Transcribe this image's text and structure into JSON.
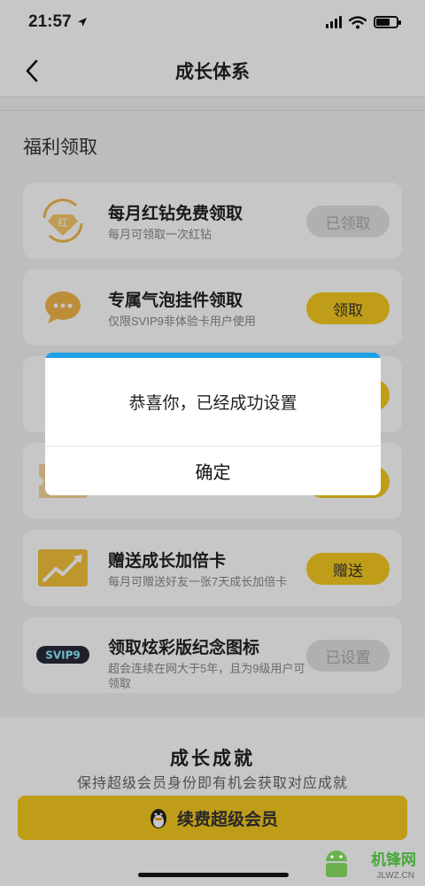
{
  "status": {
    "time": "21:57"
  },
  "nav": {
    "title": "成长体系"
  },
  "section": {
    "title": "福利领取"
  },
  "cards": [
    {
      "title": "每月红钻免费领取",
      "subtitle": "每月可领取一次红钻",
      "button": "已领取",
      "icon_label": "红",
      "state": "disabled"
    },
    {
      "title": "专属气泡挂件领取",
      "subtitle": "仅限SVIP9非体验卡用户使用",
      "button": "领取",
      "state": "active"
    },
    {
      "title": "",
      "subtitle": "",
      "button": "",
      "state": "active"
    },
    {
      "title": "",
      "subtitle": "",
      "button": "",
      "state": "active"
    },
    {
      "title": "赠送成长加倍卡",
      "subtitle": "每月可赠送好友一张7天成长加倍卡",
      "button": "赠送",
      "state": "active"
    },
    {
      "title": "领取炫彩版纪念图标",
      "subtitle": "超会连续在网大于5年，且为9级用户可领取",
      "button": "已设置",
      "icon_label": "SVIP9",
      "state": "disabled"
    }
  ],
  "footer": {
    "title": "成长成就",
    "subtitle": "保持超级会员身份即有机会获取对应成就",
    "renew_label": "续费超级会员"
  },
  "dialog": {
    "message": "恭喜你，已经成功设置",
    "confirm_label": "确定"
  },
  "watermark": {
    "text": "机锋网",
    "url": "JLWZ.CN"
  },
  "colors": {
    "accent_yellow": "#f5c91f",
    "dialog_accent": "#1ea0e6",
    "disabled_button": "#e2e2e2"
  }
}
